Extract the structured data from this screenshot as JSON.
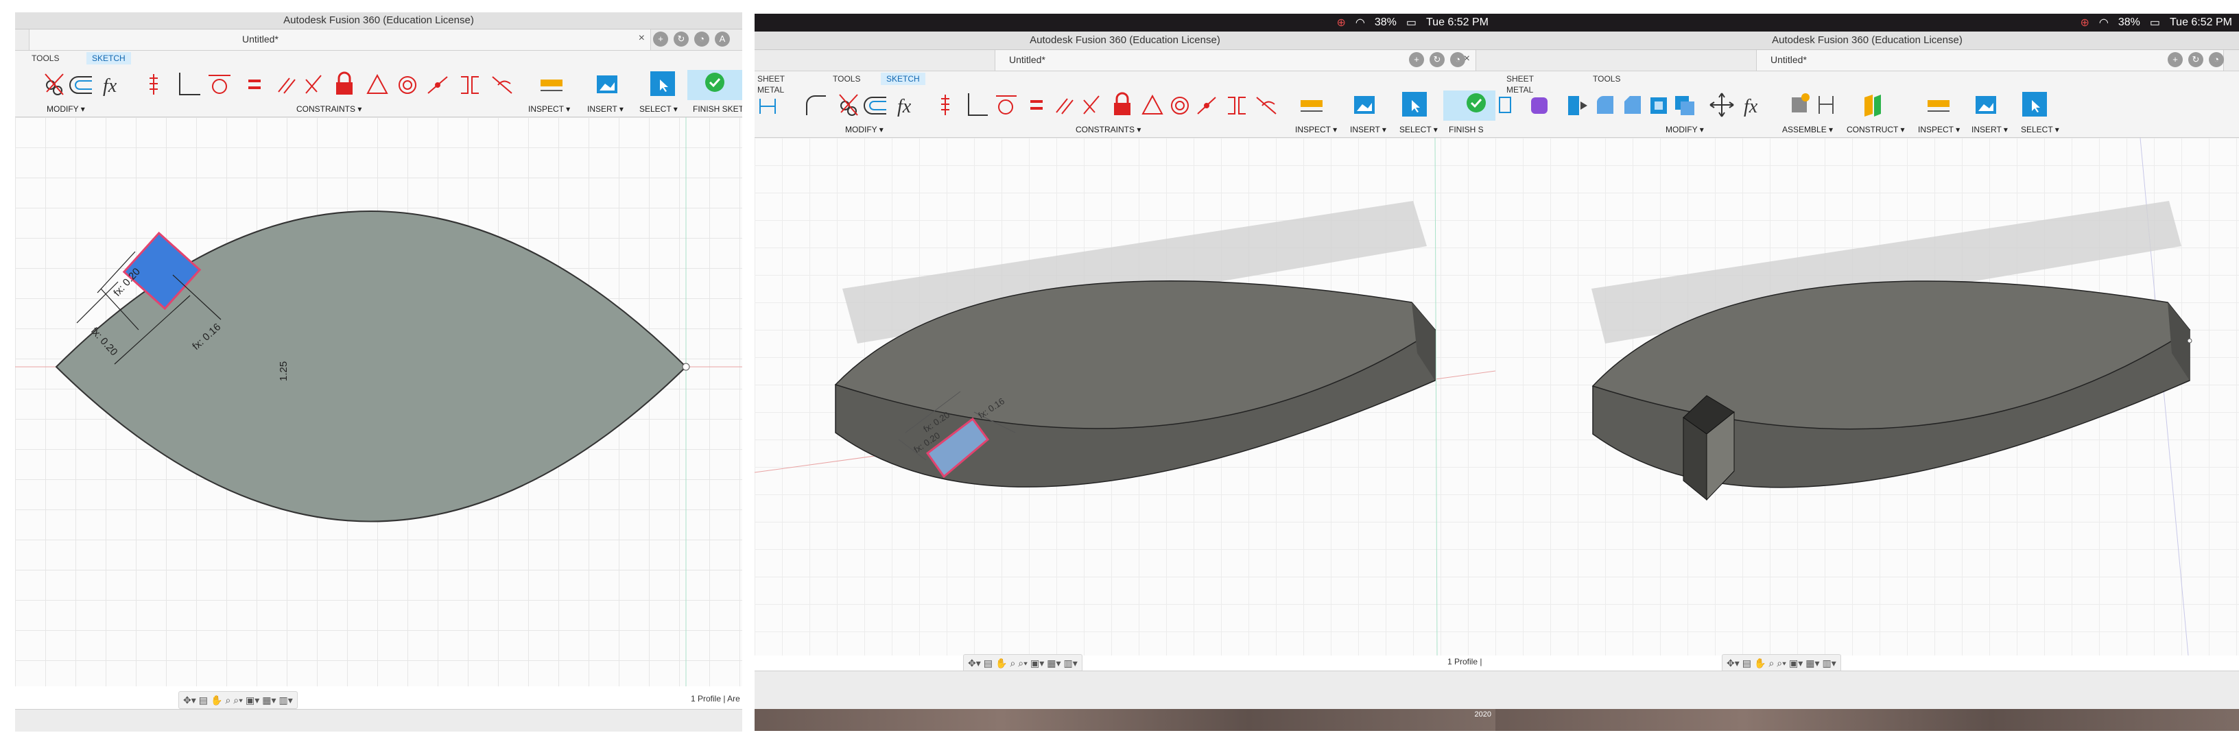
{
  "clock": "Tue 6:52 PM",
  "battery": "38%",
  "app_title": "Autodesk Fusion 360 (Education License)",
  "doc_name": "Untitled*",
  "tabs": {
    "tools": "TOOLS",
    "sketch": "SKETCH",
    "sheet_metal": "SHEET METAL"
  },
  "groups": {
    "modify": "MODIFY ▾",
    "constraints": "CONSTRAINTS ▾",
    "inspect": "INSPECT ▾",
    "insert": "INSERT ▾",
    "select": "SELECT ▾",
    "finish_sketch": "FINISH SKETCH",
    "finish_sketch_cut": "FINISH S",
    "assemble": "ASSEMBLE ▾",
    "construct": "CONSTRUCT ▾"
  },
  "dimensions": {
    "d1": "fx: 0.20",
    "d2": "fx: 0.20",
    "d3": "fx: 0.16",
    "d4": "1.25"
  },
  "status": {
    "profile_full": "1 Profile | Are",
    "profile_short": "1 Profile |"
  },
  "year": "2020",
  "colors": {
    "body": "#6b6b66",
    "sketch_face": "#8f9a94",
    "sketch_select": "#3c7ddb",
    "highlight": "#e2436f",
    "accent": "#1a8fd7"
  }
}
